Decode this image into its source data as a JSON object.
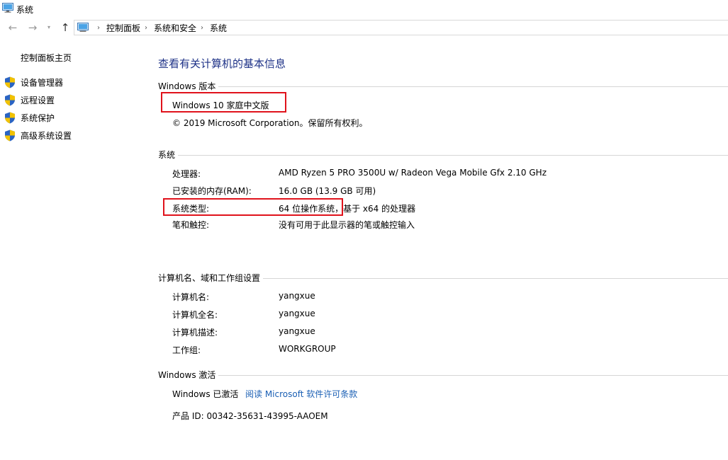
{
  "window": {
    "title": "系统",
    "icon": "monitor-icon"
  },
  "nav": {
    "back": "←",
    "forward": "→",
    "recent": "▾",
    "up": "↑",
    "breadcrumb": [
      "控制面板",
      "系统和安全",
      "系统"
    ],
    "separator": "›"
  },
  "sidebar": {
    "home": "控制面板主页",
    "items": [
      {
        "label": "设备管理器",
        "icon": "uac-shield-icon"
      },
      {
        "label": "远程设置",
        "icon": "uac-shield-icon"
      },
      {
        "label": "系统保护",
        "icon": "uac-shield-icon"
      },
      {
        "label": "高级系统设置",
        "icon": "uac-shield-icon"
      }
    ]
  },
  "main": {
    "title": "查看有关计算机的基本信息",
    "edition": {
      "header": "Windows 版本",
      "name": "Windows 10 家庭中文版",
      "copyright": "© 2019 Microsoft Corporation。保留所有权利。"
    },
    "system": {
      "header": "系统",
      "rows": [
        {
          "label": "处理器:",
          "value": "AMD Ryzen 5 PRO 3500U w/ Radeon Vega Mobile Gfx   2.10 GHz"
        },
        {
          "label": "已安装的内存(RAM):",
          "value": "16.0 GB (13.9 GB 可用)"
        },
        {
          "label": "系统类型:",
          "value": "64 位操作系统，基于 x64 的处理器"
        },
        {
          "label": "笔和触控:",
          "value": "没有可用于此显示器的笔或触控输入"
        }
      ]
    },
    "computer": {
      "header": "计算机名、域和工作组设置",
      "rows": [
        {
          "label": "计算机名:",
          "value": "yangxue"
        },
        {
          "label": "计算机全名:",
          "value": "yangxue"
        },
        {
          "label": "计算机描述:",
          "value": "yangxue"
        },
        {
          "label": "工作组:",
          "value": "WORKGROUP"
        }
      ]
    },
    "activation": {
      "header": "Windows 激活",
      "status": "Windows 已激活",
      "license_link": "阅读 Microsoft 软件许可条款",
      "product_id": "产品 ID: 00342-35631-43995-AAOEM"
    }
  },
  "colors": {
    "title": "#1e3287",
    "link": "#1a5fb4",
    "highlight": "#e0121b"
  }
}
